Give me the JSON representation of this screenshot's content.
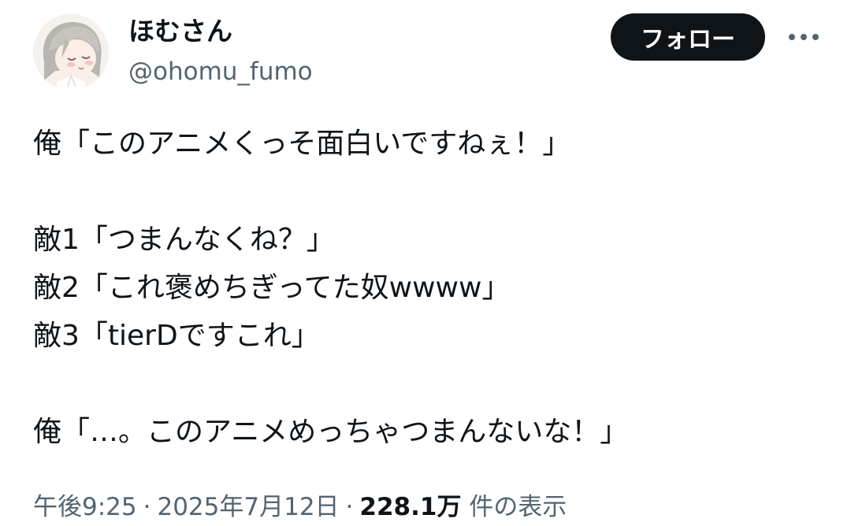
{
  "user": {
    "display_name": "ほむさん",
    "handle": "@ohomu_fumo"
  },
  "actions": {
    "follow_label": "フォロー",
    "more_icon": "more-horizontal-icon"
  },
  "tweet": {
    "lines": [
      "俺「このアニメくっそ面白いですねぇ！」",
      "",
      "敵1「つまんなくね？」",
      "敵2「これ褒めちぎってた奴wwww」",
      "敵3「tierDですこれ」",
      "",
      "俺「…。このアニメめっちゃつまんないな！」"
    ]
  },
  "meta": {
    "time": "午後9:25",
    "separator": "·",
    "date": "2025年7月12日",
    "views_count": "228.1万",
    "views_label": "件の表示"
  },
  "colors": {
    "text": "#0f1419",
    "secondary_text": "#536471",
    "follow_bg": "#0f1419",
    "follow_text": "#ffffff"
  }
}
